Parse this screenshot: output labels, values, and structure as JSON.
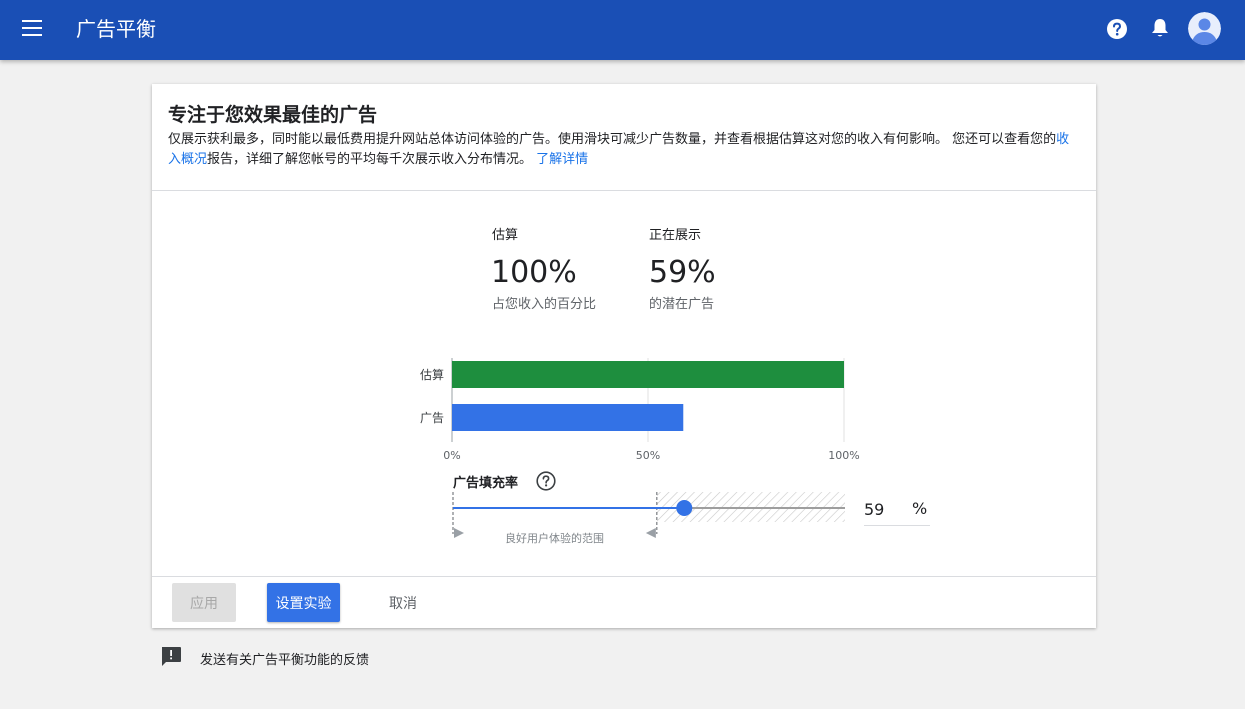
{
  "app": {
    "title": "广告平衡"
  },
  "header": {
    "title": "专注于您效果最佳的广告",
    "desc_1": "仅展示获利最多，同时能以最低费用提升网站总体访问体验的广告。使用滑块可减少广告数量，并查看根据估算这对您的收入有何影响。 您还可以查看您的",
    "desc_link_report": "收入概况",
    "desc_2": "报告，详细了解您帐号的平均每千次展示收入分布情况。",
    "desc_link_learn": "了解详情"
  },
  "stats": {
    "estimate_label": "估算",
    "estimate_value": "100%",
    "estimate_sub": "占您收入的百分比",
    "showing_label": "正在展示",
    "showing_value": "59%",
    "showing_sub": "的潜在广告"
  },
  "chart_data": {
    "type": "bar",
    "orientation": "horizontal",
    "categories": [
      "估算",
      "广告"
    ],
    "values": [
      100,
      59
    ],
    "colors": [
      "#1e8e3e",
      "#3372e6"
    ],
    "xlim": [
      0,
      100
    ],
    "xticks": [
      "0%",
      "50%",
      "100%"
    ],
    "grid": true
  },
  "slider": {
    "label": "广告填充率",
    "value": 59,
    "good_range": [
      0,
      52
    ],
    "caption": "良好用户体验的范围",
    "unit": "%"
  },
  "footer": {
    "apply_label": "应用",
    "experiment_label": "设置实验",
    "cancel_label": "取消"
  },
  "feedback": {
    "label": "发送有关广告平衡功能的反馈"
  },
  "colors": {
    "appbar": "#1a4fb5",
    "accent": "#3372e6",
    "estimate_bar": "#1e8e3e"
  }
}
